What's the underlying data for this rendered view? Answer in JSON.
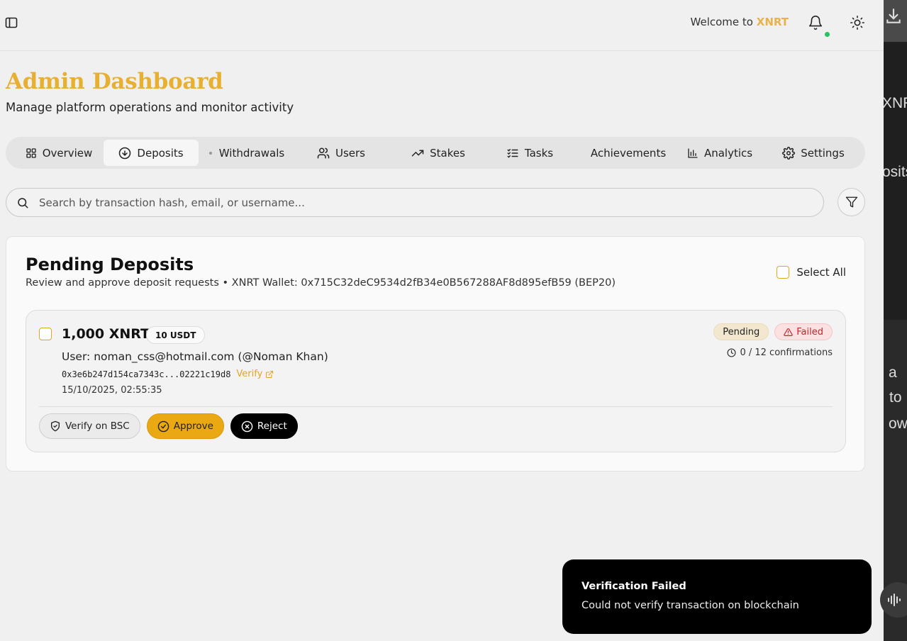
{
  "header": {
    "welcome_prefix": "Welcome to",
    "brand": "XNRT"
  },
  "page": {
    "title": "Admin Dashboard",
    "subtitle": "Manage platform operations and monitor activity"
  },
  "tabs": [
    {
      "label": "Overview",
      "icon": "grid-icon"
    },
    {
      "label": "Deposits",
      "icon": "arrow-down-circle-icon",
      "active": true
    },
    {
      "label": "Withdrawals",
      "icon": "dot-icon"
    },
    {
      "label": "Users",
      "icon": "users-icon"
    },
    {
      "label": "Stakes",
      "icon": "trending-up-icon"
    },
    {
      "label": "Tasks",
      "icon": "list-checks-icon"
    },
    {
      "label": "Achievements",
      "icon": ""
    },
    {
      "label": "Analytics",
      "icon": "bar-chart-icon"
    },
    {
      "label": "Settings",
      "icon": "gear-icon"
    }
  ],
  "search": {
    "placeholder": "Search by transaction hash, email, or username..."
  },
  "card": {
    "title": "Pending Deposits",
    "subtitle": "Review and approve deposit requests • XNRT Wallet: 0x715C32deC9534d2fB34e0B567288AF8d895efB59 (BEP20)",
    "select_all": "Select All"
  },
  "deposit": {
    "amount": "1,000 XNRT",
    "usdt": "10 USDT",
    "user": "User: noman_css@hotmail.com (@Noman Khan)",
    "hash": "0x3e6b247d154ca7343c...02221c19d8",
    "verify_link": "Verify",
    "time": "15/10/2025, 02:55:35",
    "status_pending": "Pending",
    "status_failed": "Failed",
    "confirmations": "0 / 12 confirmations",
    "btn_verify": "Verify on BSC",
    "btn_approve": "Approve",
    "btn_reject": "Reject"
  },
  "toast": {
    "title": "Verification Failed",
    "description": "Could not verify transaction on blockchain"
  },
  "side_panel": {
    "fragments": [
      "XNRT",
      "osits",
      "a",
      "to",
      "ow"
    ]
  },
  "colors": {
    "brand": "#e8b030",
    "approve": "#eaa913",
    "failed": "#c0262d",
    "online": "#22c55e"
  }
}
